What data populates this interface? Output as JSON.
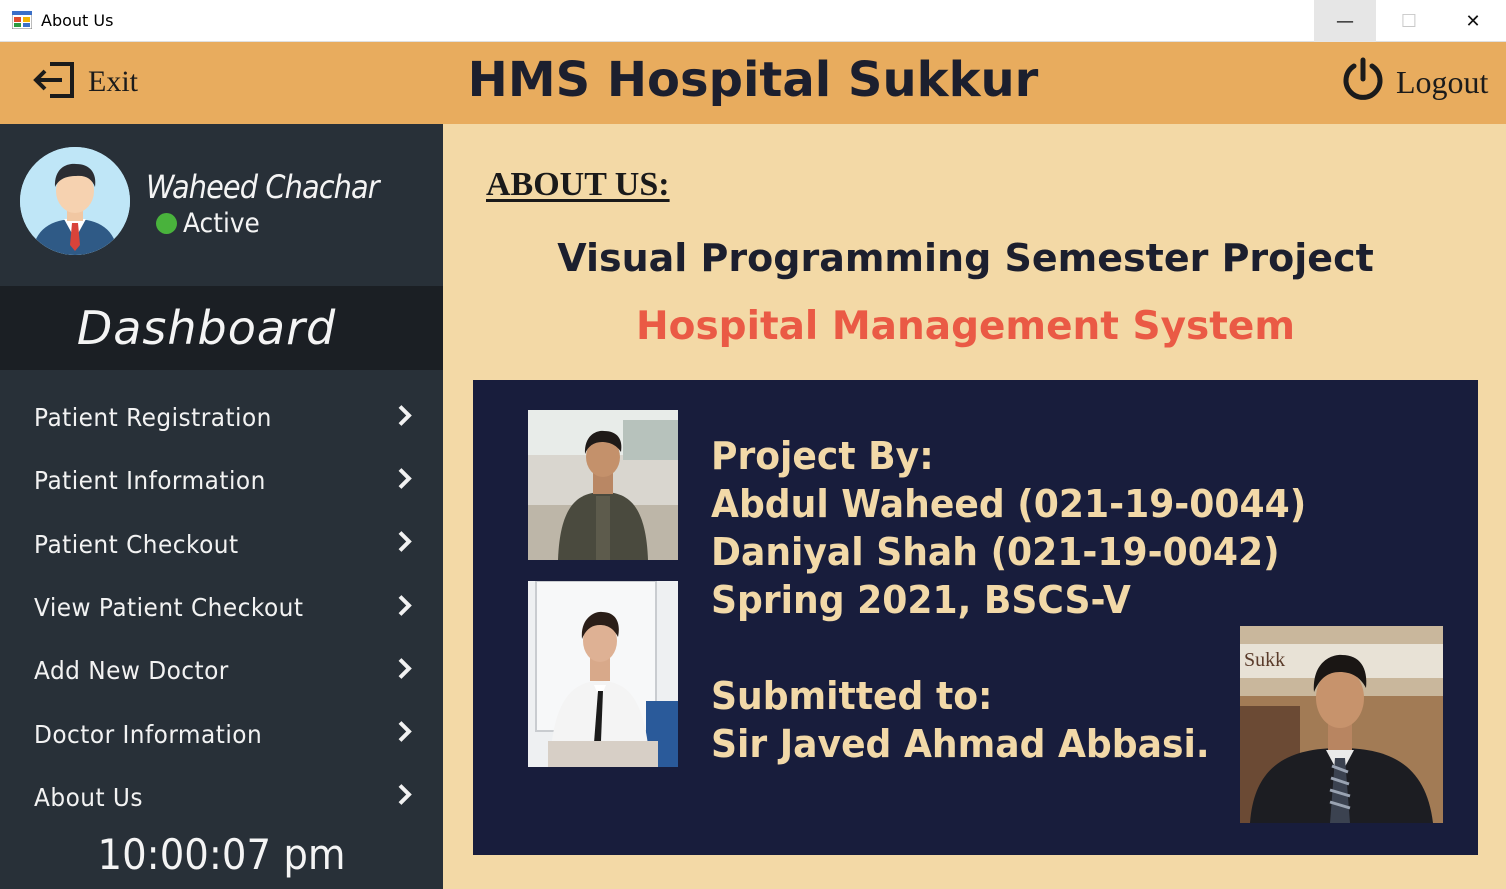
{
  "window": {
    "title": "About Us",
    "minimize_glyph": "—",
    "maximize_glyph": "☐",
    "close_glyph": "✕"
  },
  "header": {
    "exit_label": "Exit",
    "app_title": "HMS Hospital Sukkur",
    "logout_label": "Logout"
  },
  "user": {
    "name": "Waheed Chachar",
    "status": "Active"
  },
  "sidebar": {
    "dashboard_title": "Dashboard",
    "items": [
      {
        "label": "Patient Registration"
      },
      {
        "label": "Patient Information"
      },
      {
        "label": "Patient Checkout"
      },
      {
        "label": "View Patient Checkout"
      },
      {
        "label": "Add New Doctor"
      },
      {
        "label": "Doctor Information"
      },
      {
        "label": "About Us"
      }
    ],
    "clock": "10:00:07 pm"
  },
  "main": {
    "heading": "ABOUT US:",
    "subtitle": "Visual Programming Semester Project",
    "project_name": "Hospital Management System",
    "credits": {
      "project_by_label": "Project By:",
      "member1": "Abdul Waheed (021-19-0044)",
      "member2": "Daniyal Shah (021-19-0042)",
      "term": "Spring 2021, BSCS-V",
      "submitted_to_label": "Submitted to:",
      "supervisor": "Sir Javed Ahmad Abbasi."
    },
    "photo3_sign_text": "Sukk"
  },
  "colors": {
    "header_bg": "#e8ac5e",
    "sidebar_bg": "#283038",
    "dashboard_band_bg": "#1b1f24",
    "content_bg": "#f3d9a6",
    "card_bg": "#181d3c",
    "card_text": "#f2d9a8",
    "accent_red": "#ea5a45",
    "status_green": "#49b23c"
  }
}
